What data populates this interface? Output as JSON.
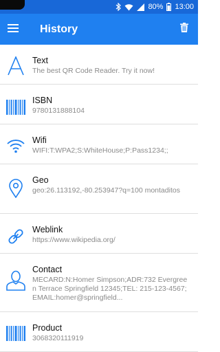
{
  "status_bar": {
    "battery": "80%",
    "time": "13:00",
    "bluetooth_icon": "bluetooth-icon",
    "wifi_icon": "wifi-icon",
    "battery_icon": "battery-icon"
  },
  "app_bar": {
    "title": "History",
    "menu_icon": "hamburger-menu-icon",
    "delete_icon": "trash-icon"
  },
  "colors": {
    "app_bar": "#1f80f0",
    "status_bar": "#1868d8",
    "icon_blue": "#1f80f0"
  },
  "items": [
    {
      "icon": "text-icon",
      "title": "Text",
      "detail": "The best QR Code Reader. Try it now!"
    },
    {
      "icon": "barcode-icon",
      "title": "ISBN",
      "detail": "9780131888104"
    },
    {
      "icon": "wifi-icon",
      "title": "Wifi",
      "detail": "WIFI:T:WPA2;S:WhiteHouse;P:Pass1234;;"
    },
    {
      "icon": "location-pin-icon",
      "title": "Geo",
      "detail": "geo:26.113192,-80.253947?q=100 montaditos"
    },
    {
      "icon": "link-icon",
      "title": "Weblink",
      "detail": "https://www.wikipedia.org/"
    },
    {
      "icon": "person-icon",
      "title": "Contact",
      "detail": "MECARD:N:Homer Simpson;ADR:732 Evergreen Terrace Springfield 12345;TEL: 215-123-4567;EMAIL:homer@springfield..."
    },
    {
      "icon": "barcode-icon",
      "title": "Product",
      "detail": "3068320111919"
    }
  ]
}
